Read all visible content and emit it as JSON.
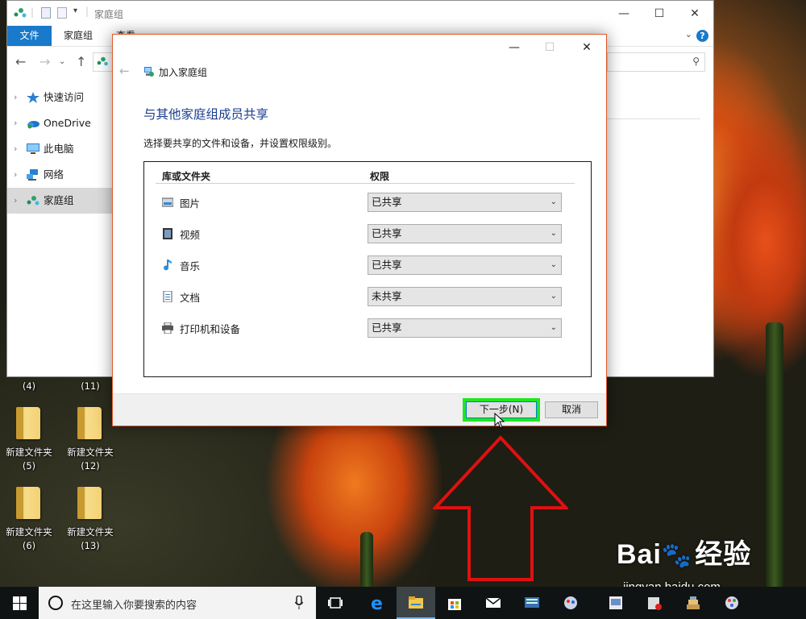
{
  "explorer": {
    "title": "家庭组",
    "tabs": {
      "file": "文件",
      "homegroup": "家庭组",
      "view": "查看"
    },
    "sidebar": [
      {
        "label": "快速访问",
        "icon": "star-icon"
      },
      {
        "label": "OneDrive",
        "icon": "onedrive-icon"
      },
      {
        "label": "此电脑",
        "icon": "pc-icon"
      },
      {
        "label": "网络",
        "icon": "network-icon"
      },
      {
        "label": "家庭组",
        "icon": "homegroup-icon",
        "selected": true
      }
    ]
  },
  "desktop": {
    "icons": [
      {
        "name": "",
        "count": "(4)"
      },
      {
        "name": "",
        "count": "(11)"
      },
      {
        "name": "新建文件夹",
        "count": "(5)"
      },
      {
        "name": "新建文件夹",
        "count": "(12)"
      },
      {
        "name": "新建文件夹",
        "count": "(6)"
      },
      {
        "name": "新建文件夹",
        "count": "(13)"
      }
    ]
  },
  "dialog": {
    "title": "加入家庭组",
    "heading": "与其他家庭组成员共享",
    "description": "选择要共享的文件和设备，并设置权限级别。",
    "col_library": "库或文件夹",
    "col_permission": "权限",
    "rows": [
      {
        "label": "图片",
        "icon": "pictures-icon",
        "permission": "已共享"
      },
      {
        "label": "视频",
        "icon": "videos-icon",
        "permission": "已共享"
      },
      {
        "label": "音乐",
        "icon": "music-icon",
        "permission": "已共享"
      },
      {
        "label": "文档",
        "icon": "documents-icon",
        "permission": "未共享"
      },
      {
        "label": "打印机和设备",
        "icon": "printer-icon",
        "permission": "已共享"
      }
    ],
    "next_button": "下一步(N)",
    "cancel_button": "取消",
    "highlight_color": "#1ee81e"
  },
  "taskbar": {
    "search_placeholder": "在这里输入你要搜索的内容",
    "icons": [
      "task-view-icon",
      "edge-icon",
      "file-explorer-icon",
      "store-icon",
      "mail-icon",
      "app-icon-1",
      "app-icon-2",
      "app-icon-3",
      "app-icon-4",
      "app-icon-5",
      "app-icon-6"
    ]
  },
  "watermark": {
    "brand": "Bai",
    "brand_cn": "经验",
    "url": "jingyan.baidu.com"
  },
  "colors": {
    "accent": "#1979ca",
    "heading": "#1a3d8f",
    "arrow": "#e01010",
    "dialog_border": "#e15a28"
  }
}
